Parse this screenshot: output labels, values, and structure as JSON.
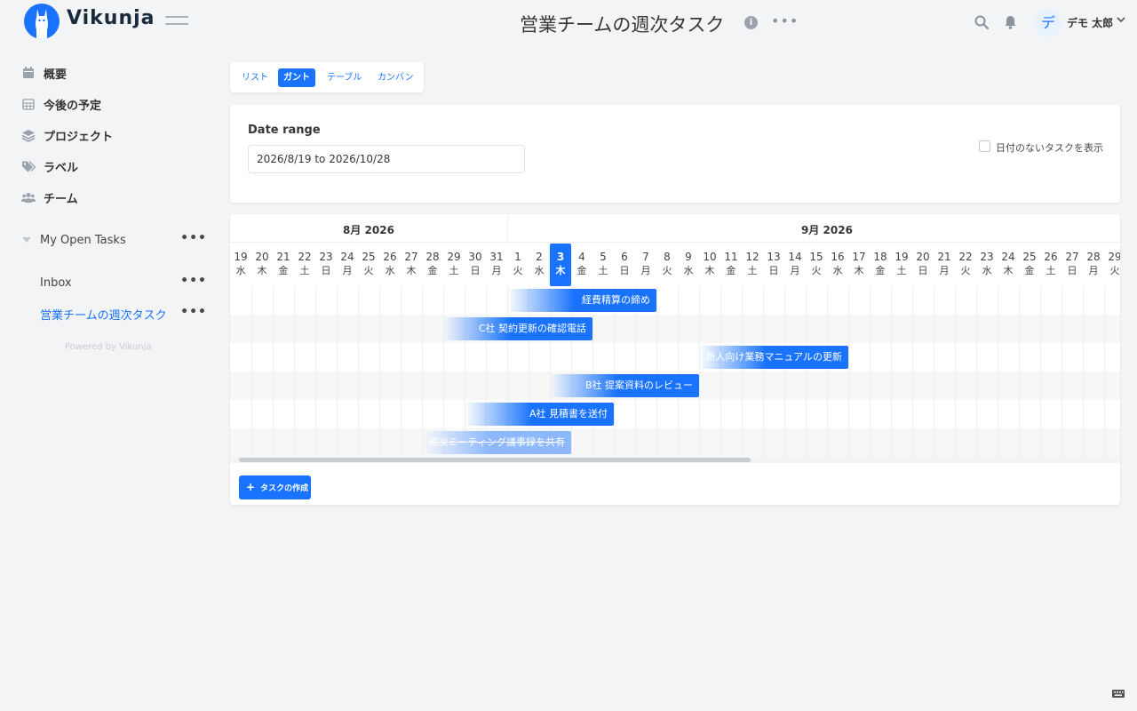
{
  "app": {
    "name": "Vikunja"
  },
  "header": {
    "title": "営業チームの週次タスク",
    "info_glyph": "i",
    "more_glyph": "•••",
    "user": {
      "avatar_initial": "デ",
      "name": "デモ 太郎"
    }
  },
  "sidebar": {
    "nav": [
      {
        "label": "概要",
        "icon": "calendar-icon"
      },
      {
        "label": "今後の予定",
        "icon": "calendar-grid-icon"
      },
      {
        "label": "プロジェクト",
        "icon": "layers-icon"
      },
      {
        "label": "ラベル",
        "icon": "tag-icon"
      },
      {
        "label": "チーム",
        "icon": "users-icon"
      }
    ],
    "projects": [
      {
        "label": "My Open Tasks",
        "more": "•••"
      },
      {
        "label": "Inbox",
        "more": "•••"
      },
      {
        "label": "営業チームの週次タスク",
        "more": "•••"
      }
    ],
    "powered_by": "Powered by Vikunja"
  },
  "views": {
    "tabs": [
      "リスト",
      "ガント",
      "テーブル",
      "カンバン"
    ],
    "active": "ガント"
  },
  "range": {
    "label": "Date range",
    "value": "2026/8/19 to 2026/10/28",
    "show_undated_label": "日付のないタスクを表示",
    "show_undated_checked": false
  },
  "gantt": {
    "months": [
      "8月 2026",
      "9月 2026"
    ],
    "days": [
      [
        "19",
        "水"
      ],
      [
        "20",
        "木"
      ],
      [
        "21",
        "金"
      ],
      [
        "22",
        "土"
      ],
      [
        "23",
        "日"
      ],
      [
        "24",
        "月"
      ],
      [
        "25",
        "火"
      ],
      [
        "26",
        "水"
      ],
      [
        "27",
        "木"
      ],
      [
        "28",
        "金"
      ],
      [
        "29",
        "土"
      ],
      [
        "30",
        "日"
      ],
      [
        "31",
        "月"
      ],
      [
        "1",
        "火"
      ],
      [
        "2",
        "水"
      ],
      [
        "3",
        "木"
      ],
      [
        "4",
        "金"
      ],
      [
        "5",
        "土"
      ],
      [
        "6",
        "日"
      ],
      [
        "7",
        "月"
      ],
      [
        "8",
        "火"
      ],
      [
        "9",
        "水"
      ],
      [
        "10",
        "木"
      ],
      [
        "11",
        "金"
      ],
      [
        "12",
        "土"
      ],
      [
        "13",
        "日"
      ],
      [
        "14",
        "月"
      ],
      [
        "15",
        "火"
      ],
      [
        "16",
        "水"
      ],
      [
        "17",
        "木"
      ],
      [
        "18",
        "金"
      ],
      [
        "19",
        "土"
      ],
      [
        "20",
        "日"
      ],
      [
        "21",
        "月"
      ],
      [
        "22",
        "火"
      ],
      [
        "23",
        "水"
      ],
      [
        "24",
        "木"
      ],
      [
        "25",
        "金"
      ],
      [
        "26",
        "土"
      ],
      [
        "27",
        "日"
      ],
      [
        "28",
        "月"
      ],
      [
        "29",
        "火"
      ]
    ],
    "today": "2026-09-03",
    "tasks": [
      {
        "title": "経費精算の締め",
        "start": "2026-09-01",
        "end": "2026-09-08",
        "done": false
      },
      {
        "title": "C社 契約更新の確認電話",
        "start": "2026-08-29",
        "end": "2026-09-05",
        "done": false
      },
      {
        "title": "新人向け業務マニュアルの更新",
        "start": "2026-09-10",
        "end": "2026-09-17",
        "done": false
      },
      {
        "title": "B社 提案資料のレビュー",
        "start": "2026-09-03",
        "end": "2026-09-10",
        "done": false
      },
      {
        "title": "A社 見積書を送付",
        "start": "2026-08-30",
        "end": "2026-09-06",
        "done": false
      },
      {
        "title": "週次ミーティング議事録を共有",
        "start": "2026-08-28",
        "end": "2026-09-04",
        "done": true
      }
    ],
    "create_label": "タスクの作成",
    "create_glyph": "+"
  },
  "colors": {
    "accent": "#1973ff",
    "done_bar": "#8db8ff"
  }
}
